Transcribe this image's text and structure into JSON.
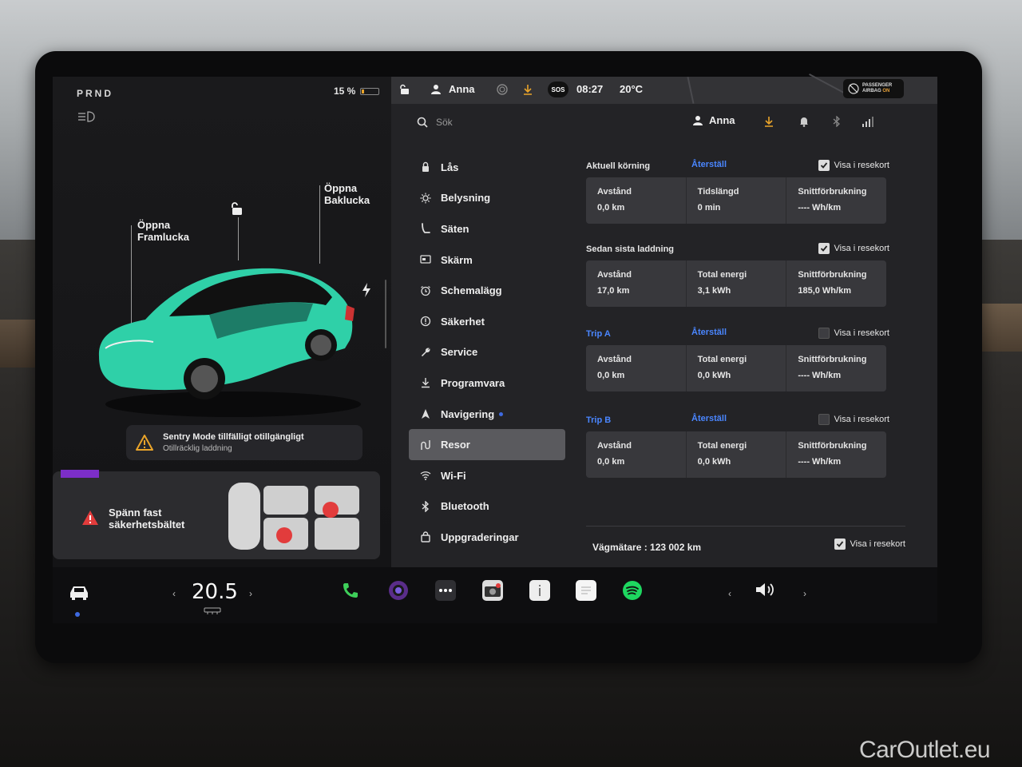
{
  "left_panel": {
    "gear": "PRND",
    "battery_percent": "15 %",
    "battery_level": 0.15,
    "frunk_label": "Öppna\nFramlucka",
    "trunk_label": "Öppna\nBaklucka",
    "car_color": "#2fd0a8",
    "sentry": {
      "title": "Sentry Mode tillfälligt otillgängligt",
      "subtitle": "Otillräcklig laddning"
    },
    "seatbelt_warning": "Spänn fast\nsäkerhetsbältet"
  },
  "status_bar": {
    "user": "Anna",
    "sos": "SOS",
    "time": "08:27",
    "temperature": "20°C",
    "airbag_line1": "PASSENGER",
    "airbag_line2": "AIRBAG",
    "airbag_status": "ON"
  },
  "settings": {
    "search_placeholder": "Sök",
    "user": "Anna",
    "nav": [
      {
        "label": "Lås",
        "icon": "lock-icon"
      },
      {
        "label": "Belysning",
        "icon": "light-icon"
      },
      {
        "label": "Säten",
        "icon": "seat-icon"
      },
      {
        "label": "Skärm",
        "icon": "screen-icon"
      },
      {
        "label": "Schemalägg",
        "icon": "clock-icon"
      },
      {
        "label": "Säkerhet",
        "icon": "info-icon"
      },
      {
        "label": "Service",
        "icon": "wrench-icon"
      },
      {
        "label": "Programvara",
        "icon": "download-icon"
      },
      {
        "label": "Navigering",
        "icon": "navigation-icon"
      },
      {
        "label": "Resor",
        "icon": "trips-icon"
      },
      {
        "label": "Wi-Fi",
        "icon": "wifi-icon"
      },
      {
        "label": "Bluetooth",
        "icon": "bluetooth-icon"
      },
      {
        "label": "Uppgraderingar",
        "icon": "bag-icon"
      }
    ],
    "sections": [
      {
        "title": "Aktuell körning",
        "reset": "Återställ",
        "show_label": "Visa i resekort",
        "checked": true,
        "stats": [
          {
            "label": "Avstånd",
            "value": "0,0 km"
          },
          {
            "label": "Tidslängd",
            "value": "0 min"
          },
          {
            "label": "Snittförbrukning",
            "value": "---- Wh/km"
          }
        ]
      },
      {
        "title": "Sedan sista laddning",
        "reset": "",
        "show_label": "Visa i resekort",
        "checked": true,
        "stats": [
          {
            "label": "Avstånd",
            "value": "17,0 km"
          },
          {
            "label": "Total energi",
            "value": "3,1 kWh"
          },
          {
            "label": "Snittförbrukning",
            "value": "185,0 Wh/km"
          }
        ]
      },
      {
        "title": "Trip A",
        "reset": "Återställ",
        "show_label": "Visa i resekort",
        "checked": false,
        "stats": [
          {
            "label": "Avstånd",
            "value": "0,0 km"
          },
          {
            "label": "Total energi",
            "value": "0,0 kWh"
          },
          {
            "label": "Snittförbrukning",
            "value": "---- Wh/km"
          }
        ]
      },
      {
        "title": "Trip B",
        "reset": "Återställ",
        "show_label": "Visa i resekort",
        "checked": false,
        "stats": [
          {
            "label": "Avstånd",
            "value": "0,0 km"
          },
          {
            "label": "Total energi",
            "value": "0,0 kWh"
          },
          {
            "label": "Snittförbrukning",
            "value": "---- Wh/km"
          }
        ]
      }
    ],
    "odometer": "Vägmätare : 123 002 km",
    "odometer_show_label": "Visa i resekort",
    "odometer_checked": true
  },
  "bottom_bar": {
    "temperature": "20.5",
    "accent_blue": "#3e6ae1",
    "apps": [
      "phone-icon",
      "camera-icon",
      "more-icon",
      "dashcam-icon",
      "manual-icon",
      "notes-icon",
      "spotify-icon"
    ]
  },
  "watermark": "CarOutlet.eu"
}
